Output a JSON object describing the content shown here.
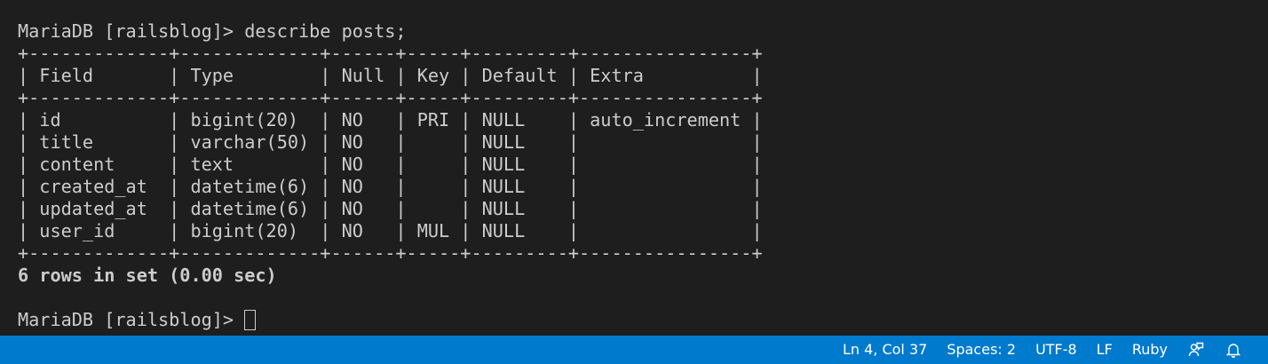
{
  "terminal": {
    "lines": [
      "MariaDB [railsblog]> describe posts;",
      "+-------------+-------------+------+-----+---------+----------------+",
      "| Field       | Type        | Null | Key | Default | Extra          |",
      "+-------------+-------------+------+-----+---------+----------------+",
      "| id          | bigint(20)  | NO   | PRI | NULL    | auto_increment |",
      "| title       | varchar(50) | NO   |     | NULL    |                |",
      "| content     | text        | NO   |     | NULL    |                |",
      "| created_at  | datetime(6) | NO   |     | NULL    |                |",
      "| updated_at  | datetime(6) | NO   |     | NULL    |                |",
      "| user_id     | bigint(20)  | NO   | MUL | NULL    |                |",
      "+-------------+-------------+------+-----+---------+----------------+",
      "6 rows in set (0.00 sec)",
      "",
      "MariaDB [railsblog]> "
    ]
  },
  "statusbar": {
    "position": "Ln 4, Col 37",
    "indentation": "Spaces: 2",
    "encoding": "UTF-8",
    "eol": "LF",
    "language": "Ruby",
    "feedback_icon": "feedback-person-icon",
    "notifications_icon": "bell-icon"
  },
  "colors": {
    "terminal_bg": "#1e1e1e",
    "terminal_fg": "#cccccc",
    "statusbar_bg": "#007acc",
    "statusbar_fg": "#ffffff"
  }
}
